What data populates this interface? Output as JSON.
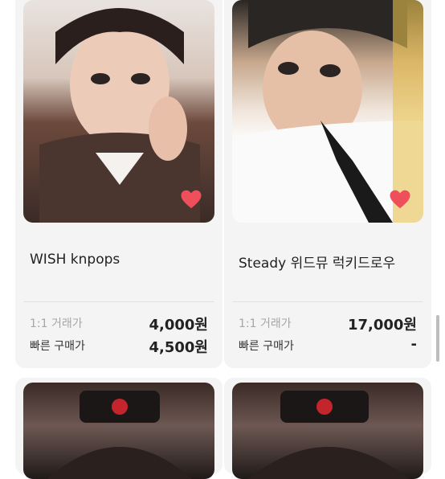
{
  "products": [
    {
      "title": "WISH knpops",
      "direct_trade_label": "1:1 거래가",
      "direct_trade_price": "4,000원",
      "quick_buy_label": "빠른 구매가",
      "quick_buy_price": "4,500원"
    },
    {
      "title": "Steady 위드뮤 럭키드로우",
      "direct_trade_label": "1:1 거래가",
      "direct_trade_price": "17,000원",
      "quick_buy_label": "빠른 구매가",
      "quick_buy_price": "-"
    }
  ],
  "colors": {
    "heart": "#ef4f5a",
    "card_bg": "#f4f4f4",
    "muted_text": "#a6a6a6"
  },
  "icons": {
    "favorite": "heart-icon"
  }
}
